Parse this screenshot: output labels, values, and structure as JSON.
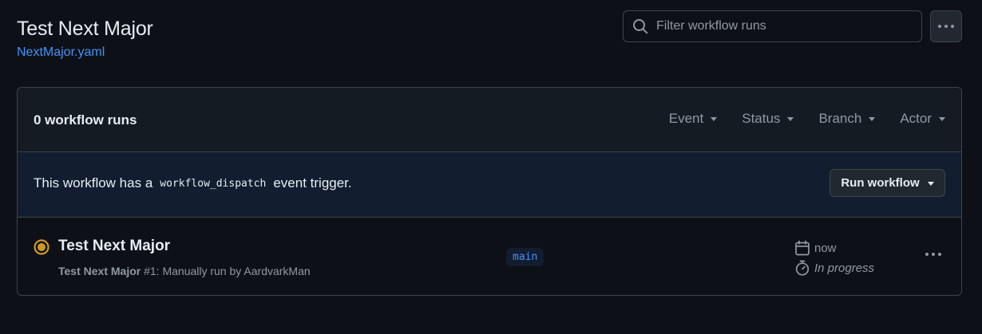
{
  "header": {
    "title": "Test Next Major",
    "workflow_file": "NextMajor.yaml"
  },
  "search": {
    "placeholder": "Filter workflow runs"
  },
  "panel": {
    "run_count": "0 workflow runs",
    "filters": [
      "Event",
      "Status",
      "Branch",
      "Actor"
    ],
    "dispatch": {
      "prefix": "This workflow has a",
      "code": "workflow_dispatch",
      "suffix": "event trigger.",
      "button_label": "Run workflow"
    }
  },
  "runs": [
    {
      "title": "Test Next Major",
      "workflow_name": "Test Next Major",
      "details": "#1: Manually run by AardvarkMan",
      "branch": "main",
      "time": "now",
      "status_text": "In progress",
      "status_icon": "in-progress-icon",
      "status_color": "#d29922"
    }
  ],
  "icons": {
    "search": "search-icon",
    "kebab": "kebab-horizontal-icon",
    "calendar": "calendar-icon",
    "stopwatch": "stopwatch-icon"
  },
  "colors": {
    "background": "#0d1117",
    "accent": "#4493f8",
    "in_progress": "#d29922"
  }
}
